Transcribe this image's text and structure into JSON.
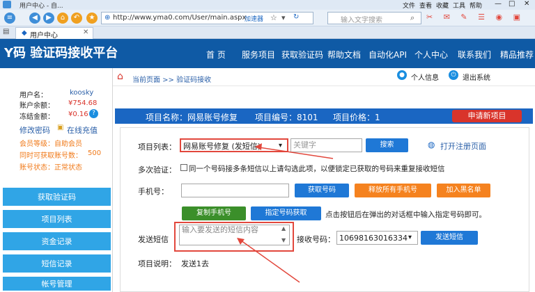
{
  "browser": {
    "title": "用户中心 - 自...",
    "url": "http://www.yma0.com/User/main.aspx",
    "accelerate": "加速器",
    "search_placeholder": "输入文字搜索",
    "tab_label": "用户中心",
    "menu_items": [
      "文件",
      "查看",
      "收藏",
      "工具",
      "帮助"
    ]
  },
  "site": {
    "logo": "Y码 验证码接收平台",
    "nav": [
      "首 页",
      "服务项目",
      "获取验证码",
      "帮助文档",
      "自动化API",
      "个人中心",
      "联系我们",
      "精品推荐"
    ]
  },
  "sidebar": {
    "username_label": "用户名：",
    "username_value": "koosky",
    "balance_label": "账户余额：",
    "balance_value": "¥754.68",
    "frozen_label": "冻结金额：",
    "frozen_value": "¥0.16",
    "change_pwd": "修改密码",
    "online_recharge": "在线充值",
    "member_level": "会员等级：自助会员",
    "simultaneous": "同时可获取账号数：",
    "simultaneous_value": "500",
    "account_status": "账号状态：正常状态",
    "nav": [
      "获取验证码",
      "项目列表",
      "资金记录",
      "短信记录",
      "帐号管理"
    ]
  },
  "breadcrumb": {
    "current": "当前页面 >> 验证码接收",
    "personal_info": "个人信息",
    "logout": "退出系统"
  },
  "project": {
    "name": "项目名称：网易账号修复",
    "id": "项目编号：8101",
    "price": "项目价格：1",
    "apply_btn": "申请新项目"
  },
  "form": {
    "project_list_label": "项目列表：",
    "project_select": "网易账号修复 (发短信)",
    "keyword_placeholder": "关键字",
    "search_btn": "搜索",
    "open_register": "打开注册页面",
    "multi_verify_label": "多次验证：",
    "multi_verify_text": "同一个号码接多条短信以上请勾选此项，以便锁定已获取的号码来重复接收短信",
    "phone_label": "手机号：",
    "get_number_btn": "获取号码",
    "release_all_btn": "释放所有手机号",
    "blacklist_btn": "加入黑名单",
    "copy_phone_btn": "复制手机号",
    "specify_btn": "指定号码获取",
    "specify_hint": "点击按钮后在弹出的对话框中输入指定号码即可。",
    "send_sms_label": "发送短信",
    "sms_placeholder": "输入要发送的短信内容",
    "receiver_label": "接收号码：",
    "receiver_value": "10698163016334",
    "send_btn": "发送短信",
    "desc_label": "项目说明：",
    "desc_value": "发送1去"
  },
  "colors": {
    "header": "#0f5aa5",
    "sidebar_nav": "#30a5e6",
    "infobar": "#1a66c2",
    "highlight": "#e2473c"
  }
}
